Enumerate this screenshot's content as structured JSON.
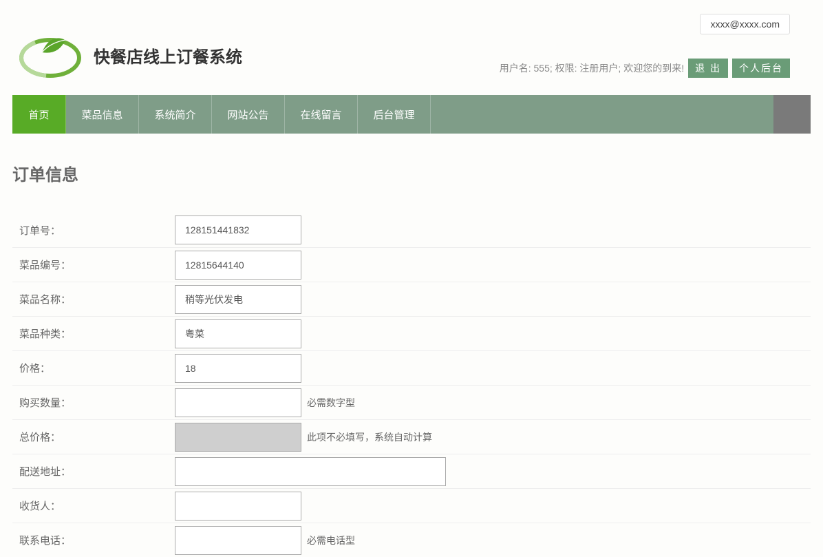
{
  "header": {
    "email": "xxxx@xxxx.com",
    "site_title": "快餐店线上订餐系统",
    "user_info": "用户名: 555; 权限: 注册用户; 欢迎您的到来!",
    "logout_label": "退 出",
    "backend_label": "个人后台"
  },
  "nav": {
    "items": [
      {
        "label": "首页",
        "active": true
      },
      {
        "label": "菜品信息",
        "active": false
      },
      {
        "label": "系统简介",
        "active": false
      },
      {
        "label": "网站公告",
        "active": false
      },
      {
        "label": "在线留言",
        "active": false
      },
      {
        "label": "后台管理",
        "active": false
      }
    ]
  },
  "page": {
    "title": "订单信息"
  },
  "form": {
    "order_no": {
      "label": "订单号：",
      "value": "128151441832"
    },
    "dish_no": {
      "label": "菜品编号：",
      "value": "12815644140"
    },
    "dish_name": {
      "label": "菜品名称：",
      "value": "稍等光伏发电"
    },
    "dish_type": {
      "label": "菜品种类：",
      "value": "粤菜"
    },
    "price": {
      "label": "价格：",
      "value": "18"
    },
    "qty": {
      "label": "购买数量：",
      "value": "",
      "hint": "必需数字型"
    },
    "total": {
      "label": "总价格：",
      "value": "",
      "hint": "此项不必填写，系统自动计算"
    },
    "address": {
      "label": "配送地址：",
      "value": ""
    },
    "receiver": {
      "label": "收货人：",
      "value": ""
    },
    "phone": {
      "label": "联系电话：",
      "value": "",
      "hint": "必需电话型"
    }
  }
}
